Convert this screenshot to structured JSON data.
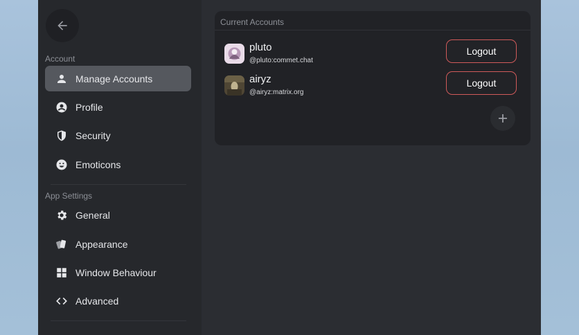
{
  "sidebar": {
    "back_icon": "arrow-left-icon",
    "account_section": "Account",
    "app_section": "App Settings",
    "account_items": [
      {
        "label": "Manage Accounts",
        "icon": "person-icon",
        "active": true
      },
      {
        "label": "Profile",
        "icon": "account-circle-icon"
      },
      {
        "label": "Security",
        "icon": "shield-icon"
      },
      {
        "label": "Emoticons",
        "icon": "emoji-icon"
      }
    ],
    "app_items": [
      {
        "label": "General",
        "icon": "gear-icon"
      },
      {
        "label": "Appearance",
        "icon": "cards-icon"
      },
      {
        "label": "Window Behaviour",
        "icon": "grid-icon"
      },
      {
        "label": "Advanced",
        "icon": "code-icon"
      }
    ]
  },
  "accounts_card": {
    "title": "Current Accounts",
    "accounts": [
      {
        "name": "pluto",
        "id": "@pluto:commet.chat",
        "action": "Logout"
      },
      {
        "name": "airyz",
        "id": "@airyz:matrix.org",
        "action": "Logout"
      }
    ],
    "add_icon": "plus-icon"
  },
  "colors": {
    "window_bg": "#2a2c31",
    "sidebar_bg": "#26282c",
    "active_item": "#55585e",
    "card_bg": "#212226",
    "logout_border": "#d05a5a"
  }
}
